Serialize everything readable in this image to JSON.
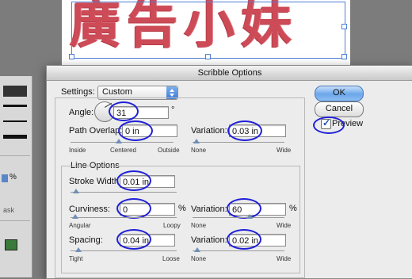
{
  "artwork": {
    "text": "廣告小妹"
  },
  "dialog": {
    "title": "Scribble Options",
    "settings_label": "Settings:",
    "settings_value": "Custom",
    "angle": {
      "label": "Angle:",
      "value": "31",
      "unit": "°"
    },
    "path_overlap": {
      "label": "Path Overlap:",
      "value": "0 in",
      "slider_left": "Inside",
      "slider_mid": "Centered",
      "slider_right": "Outside"
    },
    "path_overlap_variation": {
      "label": "Variation:",
      "value": "0.03 in",
      "slider_left": "None",
      "slider_right": "Wide"
    },
    "line_options": {
      "title": "Line Options",
      "stroke_width": {
        "label": "Stroke Width:",
        "value": "0.01 in"
      },
      "curviness": {
        "label": "Curviness:",
        "value": "0",
        "unit": "%",
        "slider_left": "Angular",
        "slider_right": "Loopy"
      },
      "curviness_variation": {
        "label": "Variation:",
        "value": "60",
        "unit": "%",
        "slider_left": "None",
        "slider_right": "Wide"
      },
      "spacing": {
        "label": "Spacing:",
        "value": "0.04 in",
        "slider_left": "Tight",
        "slider_right": "Loose"
      },
      "spacing_variation": {
        "label": "Variation:",
        "value": "0.02 in",
        "slider_left": "None",
        "slider_right": "Wide"
      }
    },
    "buttons": {
      "ok": "OK",
      "cancel": "Cancel"
    },
    "preview": {
      "label": "Preview",
      "checked": true
    },
    "annotation_color": "#2020d8"
  },
  "palette": {
    "percent_label": "%",
    "mask_label": "ask"
  }
}
